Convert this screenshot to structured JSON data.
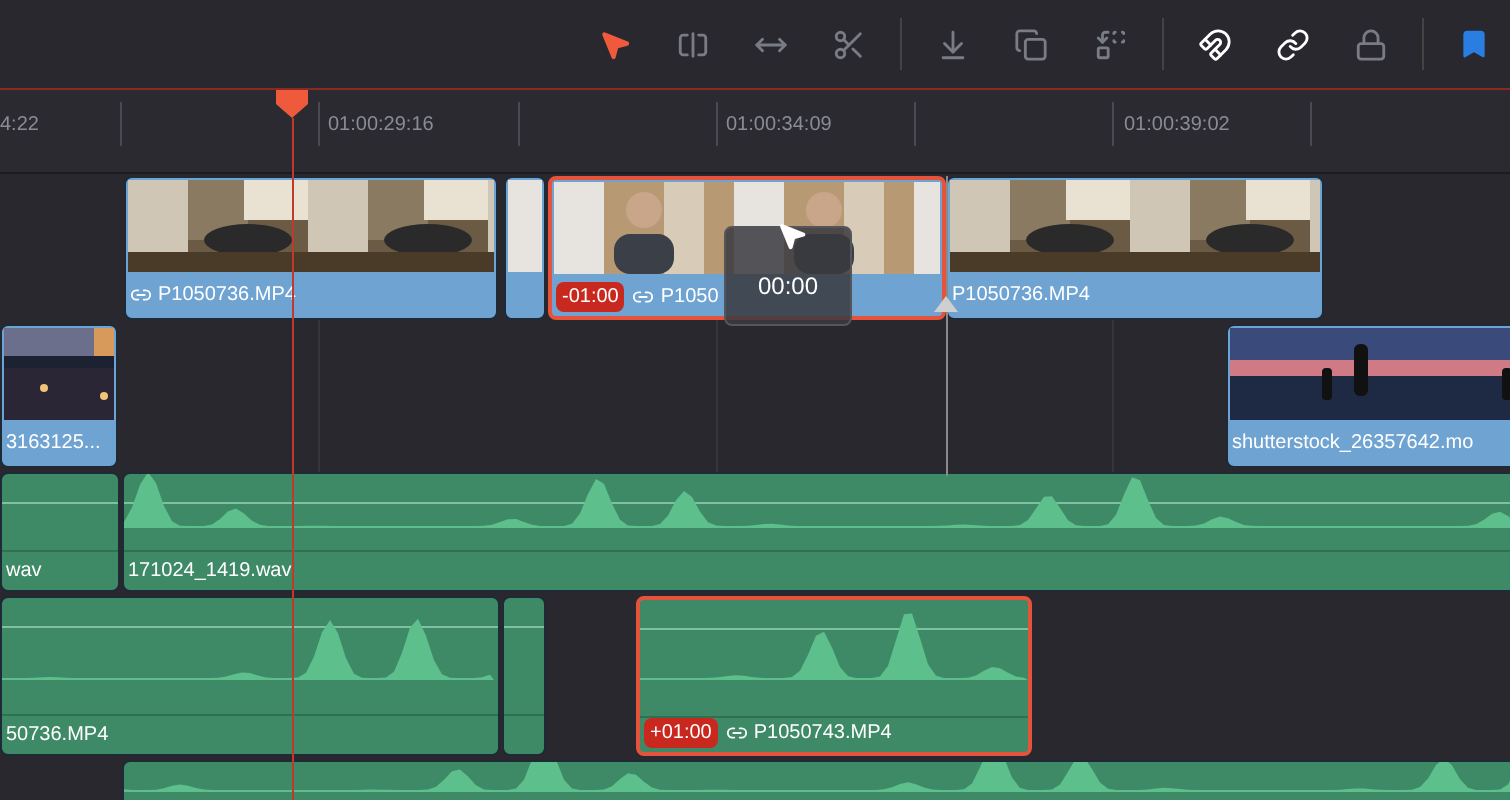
{
  "toolbar": {
    "edit_modes": [
      {
        "kind": "pointer",
        "selected": true
      },
      {
        "kind": "trim",
        "selected": false
      },
      {
        "kind": "dynamic_trim",
        "selected": false
      },
      {
        "kind": "blade",
        "selected": false
      }
    ],
    "edit_actions": [
      {
        "kind": "insert"
      },
      {
        "kind": "overwrite"
      },
      {
        "kind": "replace"
      }
    ],
    "toggles": [
      {
        "kind": "snapping",
        "on": true
      },
      {
        "kind": "linked_selection",
        "on": true
      },
      {
        "kind": "position_lock",
        "on": false
      }
    ]
  },
  "ruler": {
    "timecodes": [
      "4:22",
      "01:00:29:16",
      "01:00:34:09",
      "01:00:39:02"
    ]
  },
  "tracks": [
    {
      "kind": "video",
      "clips": [
        {
          "name": "P1050736.MP4",
          "linked": true,
          "selected": false
        },
        {
          "linked": false,
          "selected": false
        },
        {
          "name": "P1050",
          "badge": "-01:00",
          "linked": true,
          "selected": true
        },
        {
          "name": "P1050736.MP4",
          "linked": false,
          "selected": false
        }
      ]
    },
    {
      "kind": "video",
      "clips": [
        {
          "name": "3163125...",
          "linked": false,
          "selected": false
        },
        {
          "name": "shutterstock_26357642.mo",
          "linked": false,
          "selected": false
        }
      ]
    },
    {
      "kind": "audio",
      "clips": [
        {
          "name": "wav",
          "linked": false,
          "selected": false
        },
        {
          "name": "171024_1419.wav",
          "linked": false,
          "selected": false
        }
      ]
    },
    {
      "kind": "audio",
      "clips": [
        {
          "name": "50736.MP4",
          "linked": false,
          "selected": false
        },
        {
          "linked": false,
          "selected": false
        },
        {
          "name": "P1050743.MP4",
          "badge": "+01:00",
          "linked": true,
          "selected": true
        }
      ]
    },
    {
      "kind": "audio",
      "clips": [
        {
          "linked": false,
          "selected": false
        }
      ]
    }
  ],
  "tooltip": {
    "text": "00:00"
  }
}
